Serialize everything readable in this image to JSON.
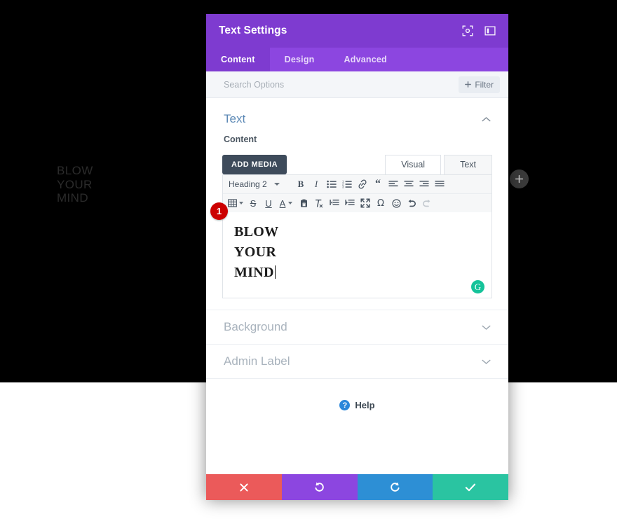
{
  "preview": {
    "heading_text": "BLOW\nYOUR\nMIND",
    "add_module_icon": "plus-icon"
  },
  "modal": {
    "title": "Text Settings",
    "header_icons": [
      {
        "name": "fullscreen-target-icon"
      },
      {
        "name": "layout-panel-icon"
      }
    ],
    "tabs": [
      {
        "label": "Content",
        "active": true
      },
      {
        "label": "Design",
        "active": false
      },
      {
        "label": "Advanced",
        "active": false
      }
    ],
    "search": {
      "placeholder": "Search Options",
      "value": ""
    },
    "filter_button": {
      "label": "Filter",
      "icon": "plus-icon"
    },
    "sections": [
      {
        "name": "text",
        "title": "Text",
        "open": true,
        "chevron": "chevron-up-icon"
      },
      {
        "name": "background",
        "title": "Background",
        "open": false,
        "chevron": "chevron-down-icon"
      },
      {
        "name": "admin-label",
        "title": "Admin Label",
        "open": false,
        "chevron": "chevron-down-icon"
      }
    ],
    "content_field": {
      "label": "Content",
      "add_media_label": "ADD MEDIA",
      "editor_tabs": [
        {
          "label": "Visual",
          "active": true
        },
        {
          "label": "Text",
          "active": false
        }
      ],
      "format_select": "Heading 2",
      "toolbar_row1": [
        {
          "name": "bold-icon",
          "glyph": "B"
        },
        {
          "name": "italic-icon",
          "glyph": "I"
        },
        {
          "name": "bulleted-list-icon"
        },
        {
          "name": "numbered-list-icon"
        },
        {
          "name": "link-icon"
        },
        {
          "name": "blockquote-icon"
        },
        {
          "name": "align-left-icon"
        },
        {
          "name": "align-center-icon"
        },
        {
          "name": "align-right-icon"
        },
        {
          "name": "align-justify-icon"
        }
      ],
      "toolbar_row2": [
        {
          "name": "table-icon"
        },
        {
          "name": "strikethrough-icon",
          "glyph": "S"
        },
        {
          "name": "underline-icon",
          "glyph": "U"
        },
        {
          "name": "text-color-icon",
          "glyph": "A"
        },
        {
          "name": "paste-as-text-icon"
        },
        {
          "name": "clear-formatting-icon"
        },
        {
          "name": "outdent-icon"
        },
        {
          "name": "indent-icon"
        },
        {
          "name": "fullscreen-icon"
        },
        {
          "name": "special-character-icon",
          "glyph": "Ω"
        },
        {
          "name": "emoji-icon"
        },
        {
          "name": "undo-icon"
        },
        {
          "name": "redo-icon"
        }
      ],
      "editor_value": "BLOW\nYOUR\nMIND",
      "step_badge": "1",
      "grammarly_icon": "grammarly-icon",
      "grammarly_glyph": "G"
    },
    "help": {
      "label": "Help",
      "icon": "question-mark-icon"
    },
    "footer_buttons": [
      {
        "name": "cancel-button",
        "icon": "close-icon",
        "color": "#eb5a5a"
      },
      {
        "name": "undo-button",
        "icon": "undo-arrow-icon",
        "color": "#8c46e0"
      },
      {
        "name": "redo-button",
        "icon": "redo-arrow-icon",
        "color": "#2d8fd5"
      },
      {
        "name": "save-button",
        "icon": "check-icon",
        "color": "#2ac4a1"
      }
    ]
  },
  "colors": {
    "header_purple": "#7e3bd0",
    "tabbar_purple": "#8c46e0",
    "section_blue": "#5b88b5",
    "badge_red": "#cc0000",
    "grammarly_green": "#15c39a"
  }
}
